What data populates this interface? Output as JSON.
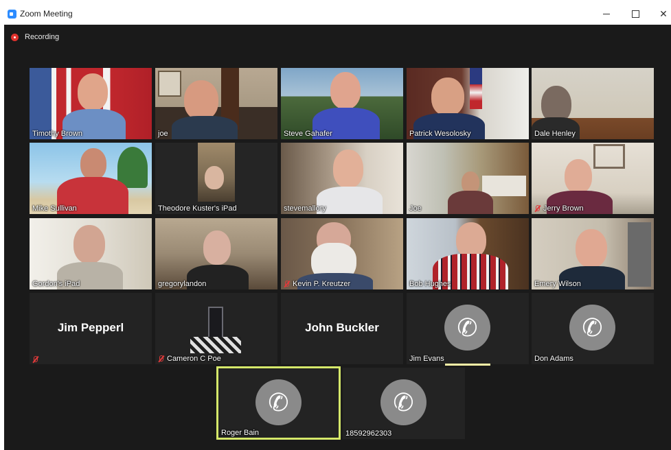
{
  "window": {
    "title": "Zoom Meeting",
    "minimize_glyph": "",
    "close_glyph": "✕"
  },
  "recording": {
    "label": "Recording"
  },
  "colors": {
    "recording": "#e0322d",
    "active_speaker_border": "#d5e86a",
    "muted_icon": "#e03a3a",
    "tile_bg": "#232323",
    "meeting_bg": "#1a1a1a"
  },
  "participants": [
    {
      "name": "Timothy Brown",
      "type": "video",
      "muted": false
    },
    {
      "name": "joe",
      "type": "video",
      "muted": false
    },
    {
      "name": "Steve Gahafer",
      "type": "video",
      "muted": false
    },
    {
      "name": "Patrick Wesolosky",
      "type": "video",
      "muted": false
    },
    {
      "name": "Dale Henley",
      "type": "video",
      "muted": false
    },
    {
      "name": "Mike Sullivan",
      "type": "video",
      "muted": false
    },
    {
      "name": "Theodore Kuster's iPad",
      "type": "video",
      "muted": false
    },
    {
      "name": "stevemallory",
      "type": "video",
      "muted": false
    },
    {
      "name": "Joe",
      "type": "video",
      "muted": false
    },
    {
      "name": "Jerry Brown",
      "type": "video",
      "muted": true
    },
    {
      "name": "Gordon's iPad",
      "type": "video",
      "muted": false
    },
    {
      "name": "gregorylandon",
      "type": "video",
      "muted": false
    },
    {
      "name": "Kevin P. Kreutzer",
      "type": "video",
      "muted": true
    },
    {
      "name": "Bob Hughes",
      "type": "video",
      "muted": false
    },
    {
      "name": "Emery Wilson",
      "type": "video",
      "muted": false
    },
    {
      "name": "Jim Pepperl",
      "type": "no-video",
      "muted": true
    },
    {
      "name": "Cameron C Poe",
      "type": "avatar",
      "muted": true
    },
    {
      "name": "John Buckler",
      "type": "no-video",
      "muted": false
    },
    {
      "name": "Jim Evans",
      "type": "phone",
      "muted": false
    },
    {
      "name": "Don Adams",
      "type": "phone",
      "muted": false
    },
    {
      "name": "Roger Bain",
      "type": "phone",
      "muted": false,
      "active_speaker": true
    },
    {
      "name": "18592962303",
      "type": "phone",
      "muted": false
    }
  ]
}
